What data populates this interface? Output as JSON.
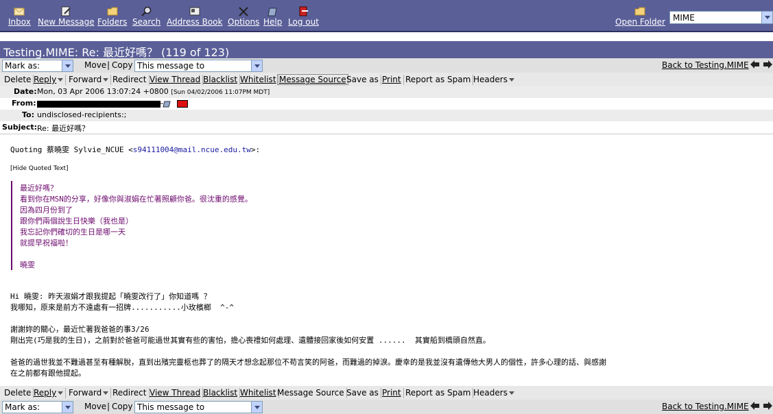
{
  "nav": {
    "inbox": "Inbox",
    "new_message": "New Message",
    "folders": "Folders",
    "search": "Search",
    "address_book": "Address Book",
    "options": "Options",
    "help": "Help",
    "logout": "Log out",
    "open_folder": "Open Folder",
    "folder_select": "MIME"
  },
  "title": "Testing.MIME: Re: 最近好嗎？ (119 of 123)",
  "toolbar": {
    "mark_as": "Mark as:",
    "move": "Move",
    "copy": "Copy",
    "target_select": "This message to",
    "back_to": "Back to Testing.MIME"
  },
  "actions": {
    "delete": "Delete",
    "reply": "Reply",
    "forward": "Forward",
    "redirect": "Redirect",
    "view_thread": "View Thread",
    "blacklist": "Blacklist",
    "whitelist": "Whitelist",
    "message_source": "Message Source",
    "save_as": "Save as",
    "print": "Print",
    "report_spam": "Report as Spam",
    "headers": "Headers"
  },
  "headers": {
    "date_label": "Date:",
    "date_value": "Mon, 03 Apr 2006 13:07:24 +0800",
    "date_local": "[Sun 04/02/2006 11:07PM MDT]",
    "from_label": "From:",
    "to_label": "To:",
    "to_value": "undisclosed-recipients:;",
    "subject_label": "Subject:",
    "subject_value": "Re: 最近好嗎？"
  },
  "message": {
    "quoting": "Quoting 蔡曉雯 Sylvie_NCUE <",
    "quoting_email": "s94111004@mail.ncue.edu.tw",
    "quoting_end": ">:",
    "hide_quoted": "[Hide Quoted Text]",
    "quoted_lines": [
      "最近好嗎？",
      "看到你在MSN的分享，好像你與淑娟在忙著照顧你爸。很沈重的感覺。",
      "因為四月份到了",
      "跟你們兩個說生日快樂（我也是）",
      "我忘記你們確切的生日是哪一天",
      "就提早祝福啦！",
      "",
      "曉雯"
    ],
    "reply_lines": [
      "Hi 曉雯: 昨天淑娟才跟我提起「曉雯改行了」你知道嗎 ？",
      "我哪知，原來是前方不遠處有一招牌...........小玫檳榔  ^-^",
      "",
      "謝謝妳的關心，最近忙著我爸爸的事3/26",
      "剛出完(巧是我的生日)，之前對於爸爸可能過世其實有些的害怕，擔心喪禮如何處理、遺體接回家後如何安置 ......  其實船到橋頭自然直。",
      "",
      "爸爸的過世我並不難過甚至有種解脫，直到出殯完靈柩也葬了的隔天才想念起那位不苟言笑的阿爸，而難過的掉淚。慶幸的是我並沒有遺傳他大男人的個性，許多心理的話、與感謝",
      "在之前都有跟他提起。"
    ]
  },
  "colors": {
    "nav_bg": "#5a5f98",
    "toolbar_bg": "#e0e0e0",
    "quote_color": "#6d0a6d"
  }
}
